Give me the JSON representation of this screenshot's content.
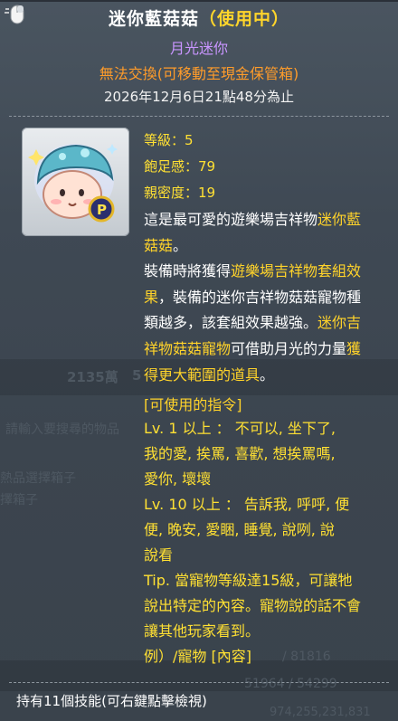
{
  "tooltip": {
    "title_name": "迷你藍菇菇",
    "title_status": "（使用中）",
    "subtitle": "月光迷你",
    "trade_note": "無法交換(可移動至現金保管箱)",
    "expire": "2026年12月6日21點48分為止",
    "icon": "mini-blue-mushroom-pet-icon",
    "stats": [
      {
        "label": "等級",
        "value": "5"
      },
      {
        "label": "飽足感",
        "value": "79"
      },
      {
        "label": "親密度",
        "value": "19"
      }
    ],
    "description_lines": [
      [
        {
          "t": "這是最可愛的遊樂場吉祥物",
          "h": false
        },
        {
          "t": "迷你藍",
          "h": true
        }
      ],
      [
        {
          "t": "菇菇",
          "h": true
        },
        {
          "t": "。",
          "h": false
        }
      ],
      [
        {
          "t": "裝備時將獲得",
          "h": false
        },
        {
          "t": "遊樂場吉祥物套組效",
          "h": true
        }
      ],
      [
        {
          "t": "果",
          "h": true
        },
        {
          "t": "，裝備的迷你吉祥物菇菇寵物種",
          "h": false
        }
      ],
      [
        {
          "t": "類越多，該套組效果越強。",
          "h": false
        },
        {
          "t": "迷你吉",
          "h": true
        }
      ],
      [
        {
          "t": "祥物菇菇寵物",
          "h": true
        },
        {
          "t": "可借助月光的力量",
          "h": false
        },
        {
          "t": "獲",
          "h": true
        }
      ],
      [
        {
          "t": "得更大範圍的道具",
          "h": true
        },
        {
          "t": "。",
          "h": false
        }
      ]
    ],
    "commands_title": "[可使用的指令]",
    "commands_lines": [
      "Lv. 1 以上 ： 不可以, 坐下了,",
      "我的愛, 挨罵, 喜歡, 想挨罵嗎,",
      "愛你, 壞壞",
      "Lv. 10 以上 ： 告訴我, 呼呼, 便",
      "便, 晚安, 愛睏, 睡覺, 說咧, 說",
      "說看",
      "Tip. 當寵物等級達15級，可讓牠",
      "說出特定的內容。寵物說的話不會",
      "讓其他玩家看到。",
      "例）/寵物 [內容]"
    ],
    "footer": "持有11個技能(可右鍵點擊檢視)"
  },
  "background": {
    "money": "2135萬",
    "money2": "5",
    "search_hint": "請輸入要搜尋的物品",
    "item_box": "熱品選擇箱子",
    "item_box2": "擇箱子",
    "hp": "/ 81816",
    "mp": "51964 / 54299",
    "exp": "974,255,231,831"
  },
  "colors": {
    "title_status": "#ffd52b",
    "subtitle": "#c995ff",
    "trade_note": "#ff9c2a",
    "highlight": "#ffd32a",
    "stats": "#ffe033"
  }
}
